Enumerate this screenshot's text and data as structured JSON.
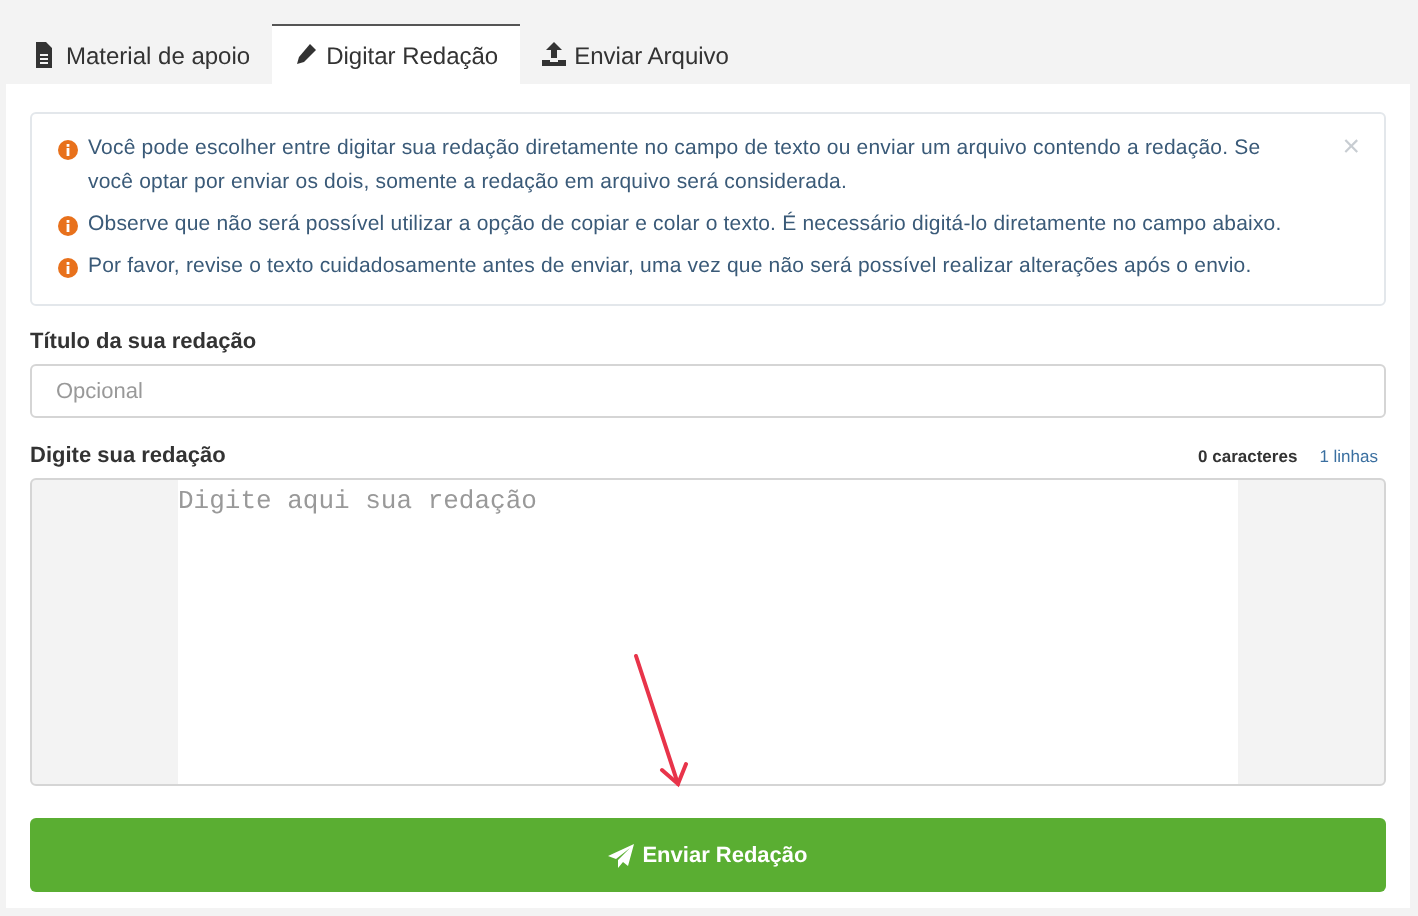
{
  "tabs": [
    {
      "label": "Material de apoio",
      "selected": false
    },
    {
      "label": "Digitar Redação",
      "selected": true
    },
    {
      "label": "Enviar Arquivo",
      "selected": false
    }
  ],
  "alert": {
    "close": "×",
    "items": [
      "Você pode escolher entre digitar sua redação diretamente no campo de texto ou enviar um arquivo contendo a redação. Se você optar por enviar os dois, somente a redação em arquivo será considerada.",
      "Observe que não será possível utilizar a opção de copiar e colar o texto. É necessário digitá-lo diretamente no campo abaixo.",
      "Por favor, revise o texto cuidadosamente antes de enviar, uma vez que não será possível realizar alterações após o envio."
    ]
  },
  "title_field": {
    "label": "Título da sua redação",
    "placeholder": "Opcional"
  },
  "essay_field": {
    "label": "Digite sua redação",
    "char_count": "0 caracteres",
    "line_count": "1 linhas",
    "placeholder": "Digite aqui sua redação"
  },
  "submit_button": {
    "label": "Enviar Redação"
  }
}
